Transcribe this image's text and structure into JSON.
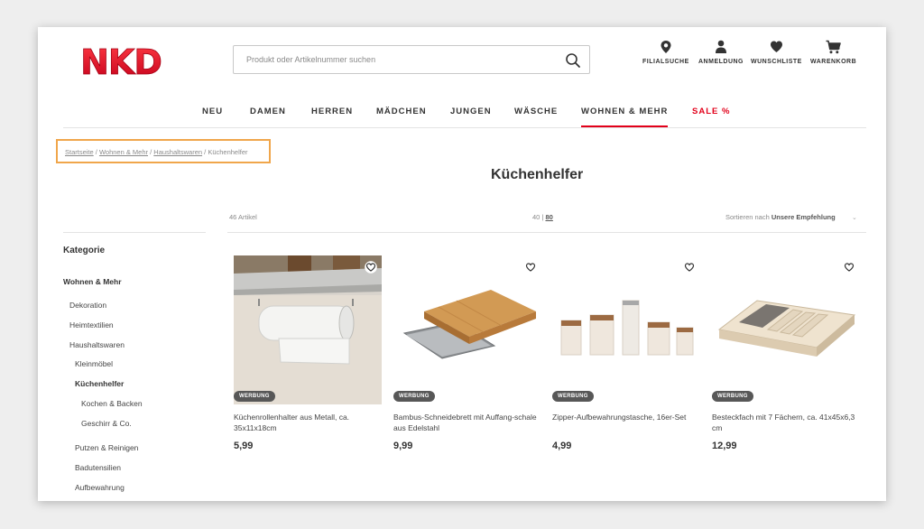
{
  "brand": {
    "logo_text": "NKD",
    "logo_color": "#e2001a"
  },
  "search": {
    "placeholder": "Produkt oder Artikelnummer suchen"
  },
  "header_icons": [
    {
      "label": "FILIALSUCHE",
      "icon": "map-pin-icon"
    },
    {
      "label": "ANMELDUNG",
      "icon": "user-icon"
    },
    {
      "label": "WUNSCHLISTE",
      "icon": "heart-icon"
    },
    {
      "label": "WARENKORB",
      "icon": "cart-icon"
    }
  ],
  "nav": [
    "NEU",
    "DAMEN",
    "HERREN",
    "MÄDCHEN",
    "JUNGEN",
    "WÄSCHE",
    "WOHNEN & MEHR",
    "SALE %"
  ],
  "nav_active": "WOHNEN & MEHR",
  "breadcrumb": [
    "Startseite",
    "Wohnen & Mehr",
    "Haushaltswaren",
    "Küchenhelfer"
  ],
  "page_title": "Küchenhelfer",
  "listing": {
    "count": "46 Artikel",
    "per_page_a": "40",
    "per_page_sep": "|",
    "per_page_b": "80",
    "sort_label": "Sortieren nach",
    "sort_value": "Unsere Empfehlung"
  },
  "sidebar": {
    "heading": "Kategorie",
    "items": [
      "Wohnen & Mehr",
      "Dekoration",
      "Heimtextilien",
      "Haushaltswaren",
      "Kleinmöbel",
      "Küchenhelfer",
      "Kochen & Backen",
      "Geschirr & Co.",
      "Putzen & Reinigen",
      "Badutensilien",
      "Aufbewahrung"
    ]
  },
  "products": [
    {
      "badge": "WERBUNG",
      "name": "Küchenrollenhalter aus Metall, ca. 35x11x18cm",
      "price": "5,99"
    },
    {
      "badge": "WERBUNG",
      "name": "Bambus-Schneidebrett mit Auffang-schale aus Edelstahl",
      "price": "9,99"
    },
    {
      "badge": "WERBUNG",
      "name": "Zipper-Aufbewahrungstasche, 16er-Set",
      "price": "4,99"
    },
    {
      "badge": "WERBUNG",
      "name": "Besteckfach mit 7 Fächern, ca. 41x45x6,3 cm",
      "price": "12,99"
    }
  ],
  "colors": {
    "accent": "#e2001a",
    "highlight_border": "#f0a64b",
    "badge_bg": "#575757"
  }
}
